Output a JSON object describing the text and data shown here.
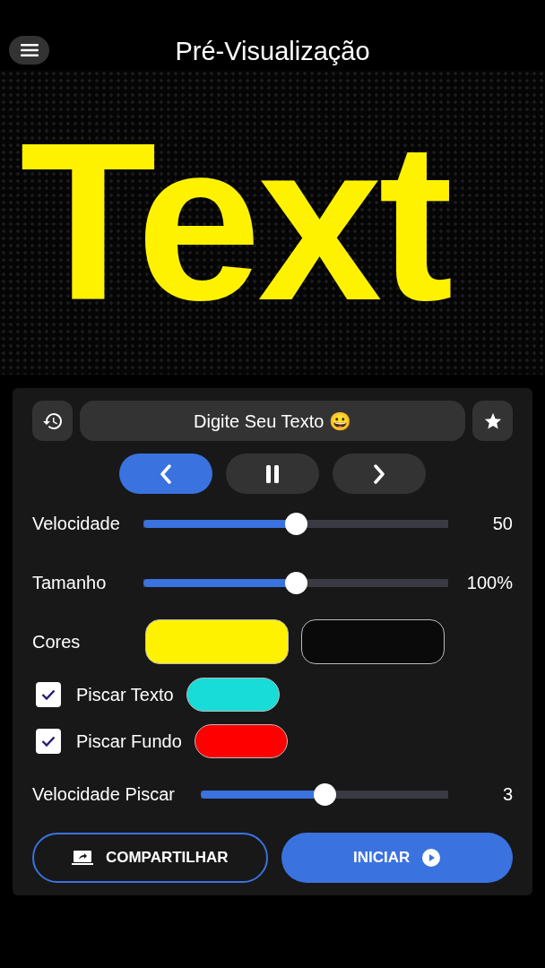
{
  "header": {
    "title": "Pré-Visualização"
  },
  "preview": {
    "text": "Text",
    "color": "#fff200"
  },
  "input": {
    "value": "Digite Seu Texto 😀"
  },
  "directions": [
    {
      "kind": "left",
      "selected": true
    },
    {
      "kind": "pause",
      "selected": false
    },
    {
      "kind": "right",
      "selected": false
    }
  ],
  "sliders": [
    {
      "label": "Velocidade",
      "level": 0.5,
      "reading": "50"
    },
    {
      "label": "Tamanho",
      "level": 0.5,
      "reading": "100%"
    }
  ],
  "colors": {
    "label": "Cores",
    "swatches": [
      {
        "color": "#fff200"
      },
      {
        "color": "#0a0a0a"
      }
    ]
  },
  "blink_options": [
    {
      "label": "Piscar Texto",
      "checked": true,
      "color": "#17dcd8"
    },
    {
      "label": "Piscar Fundo",
      "checked": true,
      "color": "#ff0000"
    }
  ],
  "blink_slider": {
    "label": "Velocidade Piscar",
    "level": 0.5,
    "reading": "3"
  },
  "buttons": [
    {
      "kind": "share",
      "label": "COMPARTILHAR"
    },
    {
      "kind": "start",
      "label": "INICIAR"
    }
  ]
}
